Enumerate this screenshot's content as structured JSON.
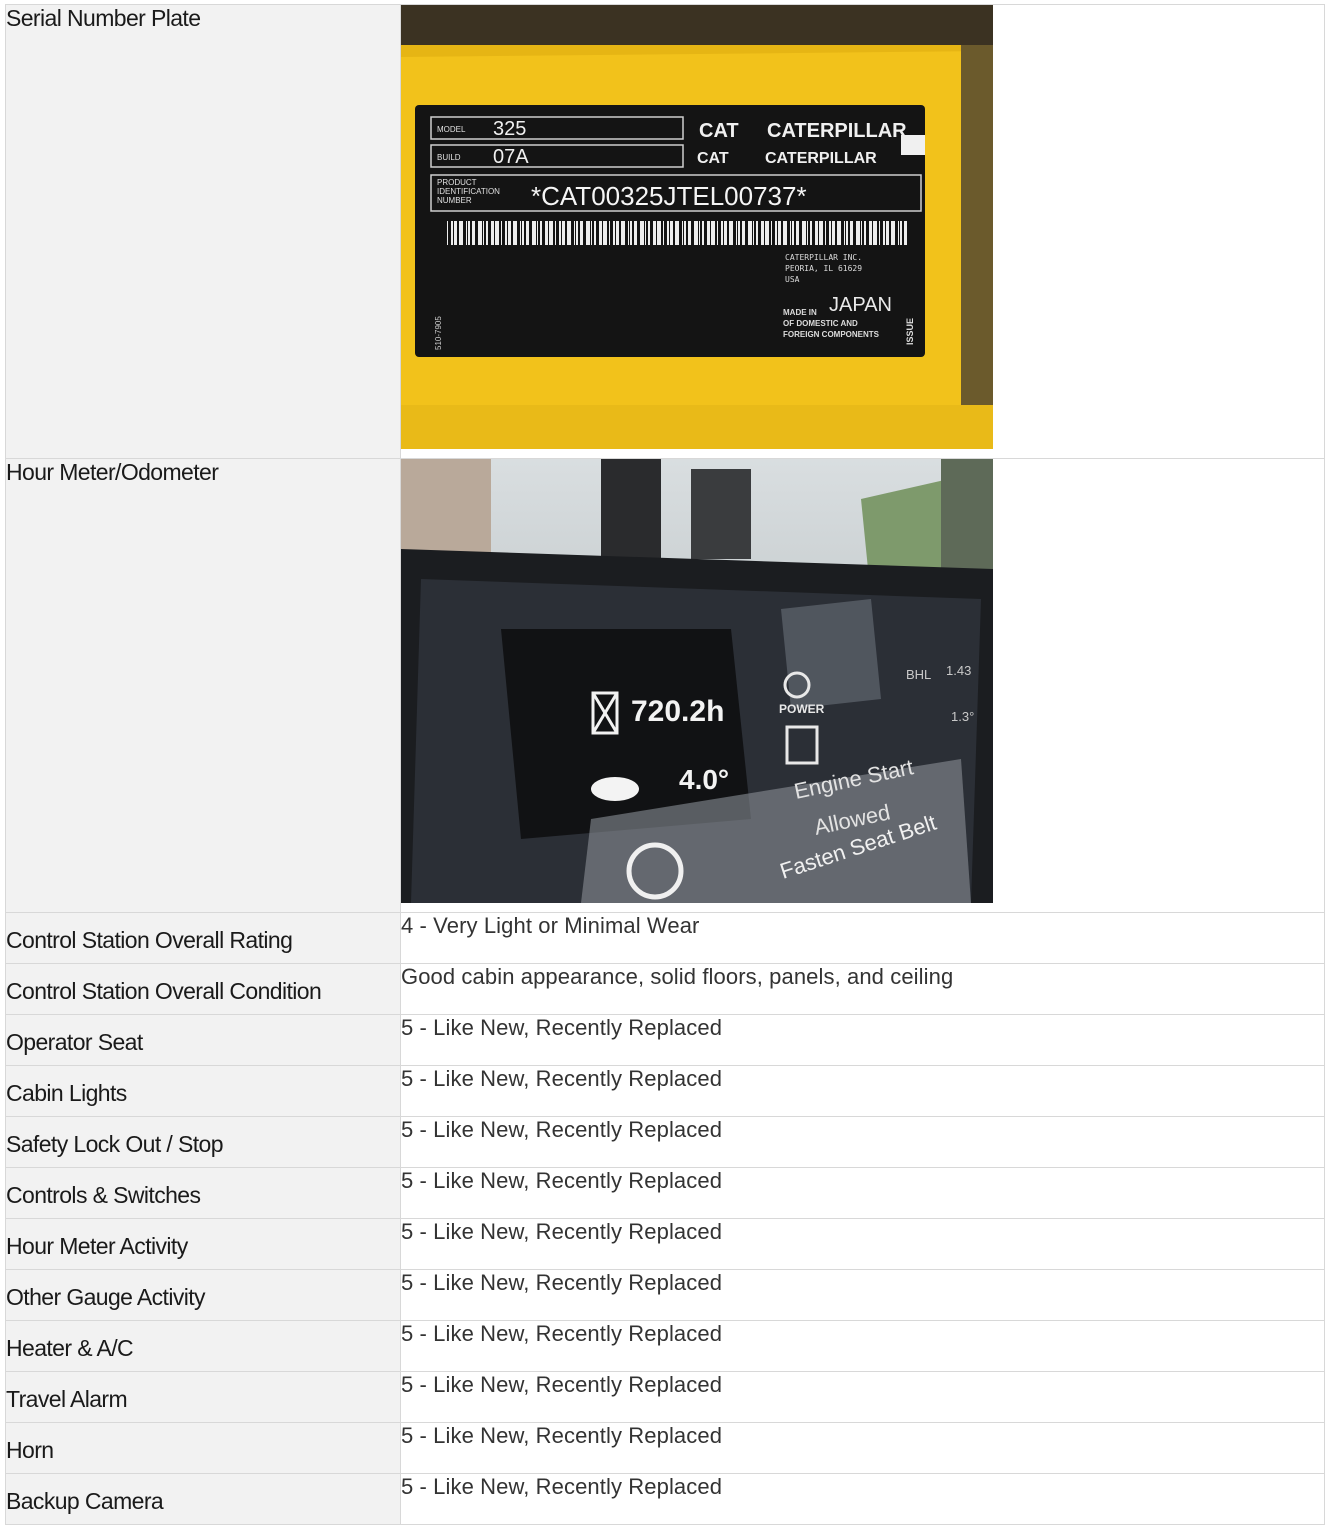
{
  "rows": [
    {
      "label": "Serial Number Plate",
      "image": "serial-number-plate-photo"
    },
    {
      "label": "Hour Meter/Odometer",
      "image": "hour-meter-photo"
    },
    {
      "label": "Control Station Overall Rating",
      "value": "4 - Very Light or Minimal Wear"
    },
    {
      "label": "Control Station Overall Condition",
      "value": "Good cabin appearance, solid floors, panels, and ceiling"
    },
    {
      "label": "Operator Seat",
      "value": "5 - Like New, Recently Replaced"
    },
    {
      "label": "Cabin Lights",
      "value": "5 - Like New, Recently Replaced"
    },
    {
      "label": "Safety Lock Out / Stop",
      "value": "5 - Like New, Recently Replaced"
    },
    {
      "label": "Controls & Switches",
      "value": "5 - Like New, Recently Replaced"
    },
    {
      "label": "Hour Meter Activity",
      "value": "5 - Like New, Recently Replaced"
    },
    {
      "label": "Other Gauge Activity",
      "value": "5 - Like New, Recently Replaced"
    },
    {
      "label": "Heater & A/C",
      "value": "5 - Like New, Recently Replaced"
    },
    {
      "label": "Travel Alarm",
      "value": "5 - Like New, Recently Replaced"
    },
    {
      "label": "Horn",
      "value": "5 - Like New, Recently Replaced"
    },
    {
      "label": "Backup Camera",
      "value": "5 - Like New, Recently Replaced"
    }
  ],
  "serial_plate": {
    "model_label": "MODEL",
    "model": "325",
    "build_label": "BUILD",
    "build": "07A",
    "pin_label_1": "PRODUCT",
    "pin_label_2": "IDENTIFICATION",
    "pin_label_3": "NUMBER",
    "pin": "*CAT00325JTEL00737*",
    "brand_short": "CAT",
    "brand_long": "CATERPILLAR",
    "maker_1": "CATERPILLAR INC.",
    "maker_2": "PEORIA, IL 61629",
    "maker_3": "USA",
    "made_in": "MADE IN",
    "country": "JAPAN",
    "origin_1": "OF DOMESTIC AND",
    "origin_2": "FOREIGN COMPONENTS",
    "issue": "ISSUE",
    "part_no": "510-7905"
  },
  "hour_meter": {
    "hours": "720.2h",
    "angle": "4.0°",
    "power": "POWER",
    "bhl": "BHL",
    "bhl_value": "1.43",
    "tilt": "1.3°",
    "msg_1": "Engine Start",
    "msg_2": "Allowed",
    "msg_3": "Fasten Seat Belt"
  },
  "colors": {
    "label_bg": "#f2f2f2",
    "border": "#d8d8d8",
    "plate_yellow": "#f2c21b",
    "plate_black": "#141414"
  }
}
